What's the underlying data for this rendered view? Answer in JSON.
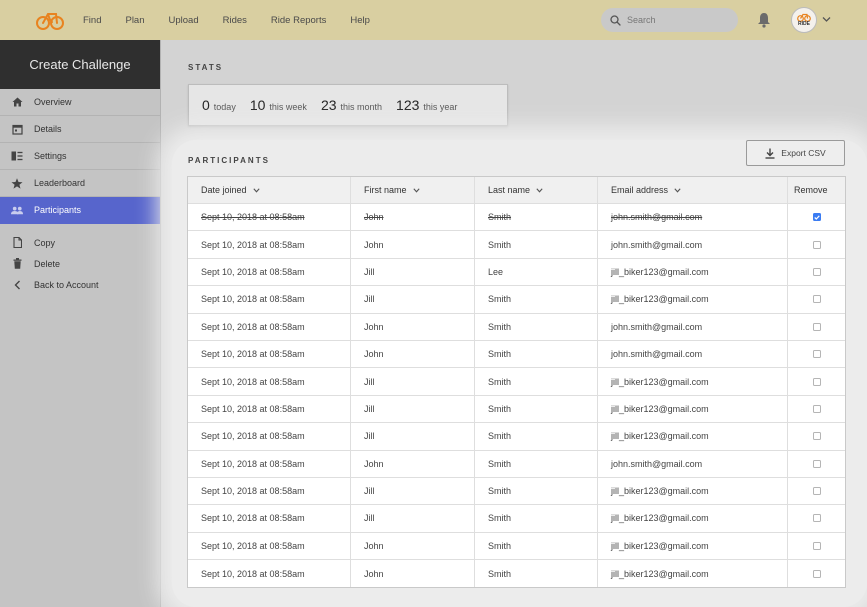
{
  "nav": {
    "items": [
      "Find",
      "Plan",
      "Upload",
      "Rides",
      "Ride Reports",
      "Help"
    ]
  },
  "search": {
    "placeholder": "Search"
  },
  "avatar": {
    "text": "RIDE"
  },
  "colors": {
    "topbar": "#d9cfa1",
    "accent": "#5765cc",
    "brand": "#e8831f"
  },
  "sidebar": {
    "title": "Create Challenge",
    "items": [
      {
        "label": "Overview",
        "icon": "home-icon"
      },
      {
        "label": "Details",
        "icon": "calendar-icon"
      },
      {
        "label": "Settings",
        "icon": "settings-icon"
      },
      {
        "label": "Leaderboard",
        "icon": "star-icon"
      },
      {
        "label": "Participants",
        "icon": "people-icon",
        "active": true
      }
    ],
    "actions": [
      {
        "label": "Copy",
        "icon": "copy-icon"
      },
      {
        "label": "Delete",
        "icon": "trash-icon"
      },
      {
        "label": "Back to Account",
        "icon": "chevron-left-icon"
      }
    ]
  },
  "stats": {
    "title": "STATS",
    "items": [
      {
        "num": "0",
        "label": "today"
      },
      {
        "num": "10",
        "label": "this week"
      },
      {
        "num": "23",
        "label": "this month"
      },
      {
        "num": "123",
        "label": "this year"
      }
    ]
  },
  "participants": {
    "title": "PARTICIPANTS",
    "export_label": "Export CSV",
    "columns": [
      "Date joined",
      "First name",
      "Last name",
      "Email address",
      "Remove"
    ],
    "rows": [
      {
        "date": "Sept 10, 2018 at 08:58am",
        "first": "John",
        "last": "Smith",
        "email": "john.smith@gmail.com",
        "removed": true
      },
      {
        "date": "Sept 10, 2018 at 08:58am",
        "first": "John",
        "last": "Smith",
        "email": "john.smith@gmail.com",
        "removed": false
      },
      {
        "date": "Sept 10, 2018 at 08:58am",
        "first": "Jill",
        "last": "Lee",
        "email": "jill_biker123@gmail.com",
        "removed": false
      },
      {
        "date": "Sept 10, 2018 at 08:58am",
        "first": "Jill",
        "last": "Smith",
        "email": "jill_biker123@gmail.com",
        "removed": false
      },
      {
        "date": "Sept 10, 2018 at 08:58am",
        "first": "John",
        "last": "Smith",
        "email": "john.smith@gmail.com",
        "removed": false
      },
      {
        "date": "Sept 10, 2018 at 08:58am",
        "first": "John",
        "last": "Smith",
        "email": "john.smith@gmail.com",
        "removed": false
      },
      {
        "date": "Sept 10, 2018 at 08:58am",
        "first": "Jill",
        "last": "Smith",
        "email": "jill_biker123@gmail.com",
        "removed": false
      },
      {
        "date": "Sept 10, 2018 at 08:58am",
        "first": "Jill",
        "last": "Smith",
        "email": "jill_biker123@gmail.com",
        "removed": false
      },
      {
        "date": "Sept 10, 2018 at 08:58am",
        "first": "Jill",
        "last": "Smith",
        "email": "jill_biker123@gmail.com",
        "removed": false
      },
      {
        "date": "Sept 10, 2018 at 08:58am",
        "first": "John",
        "last": "Smith",
        "email": "john.smith@gmail.com",
        "removed": false
      },
      {
        "date": "Sept 10, 2018 at 08:58am",
        "first": "Jill",
        "last": "Smith",
        "email": "jill_biker123@gmail.com",
        "removed": false
      },
      {
        "date": "Sept 10, 2018 at 08:58am",
        "first": "Jill",
        "last": "Smith",
        "email": "jill_biker123@gmail.com",
        "removed": false
      },
      {
        "date": "Sept 10, 2018 at 08:58am",
        "first": "John",
        "last": "Smith",
        "email": "jill_biker123@gmail.com",
        "removed": false
      },
      {
        "date": "Sept 10, 2018 at 08:58am",
        "first": "John",
        "last": "Smith",
        "email": "jill_biker123@gmail.com",
        "removed": false
      }
    ]
  }
}
